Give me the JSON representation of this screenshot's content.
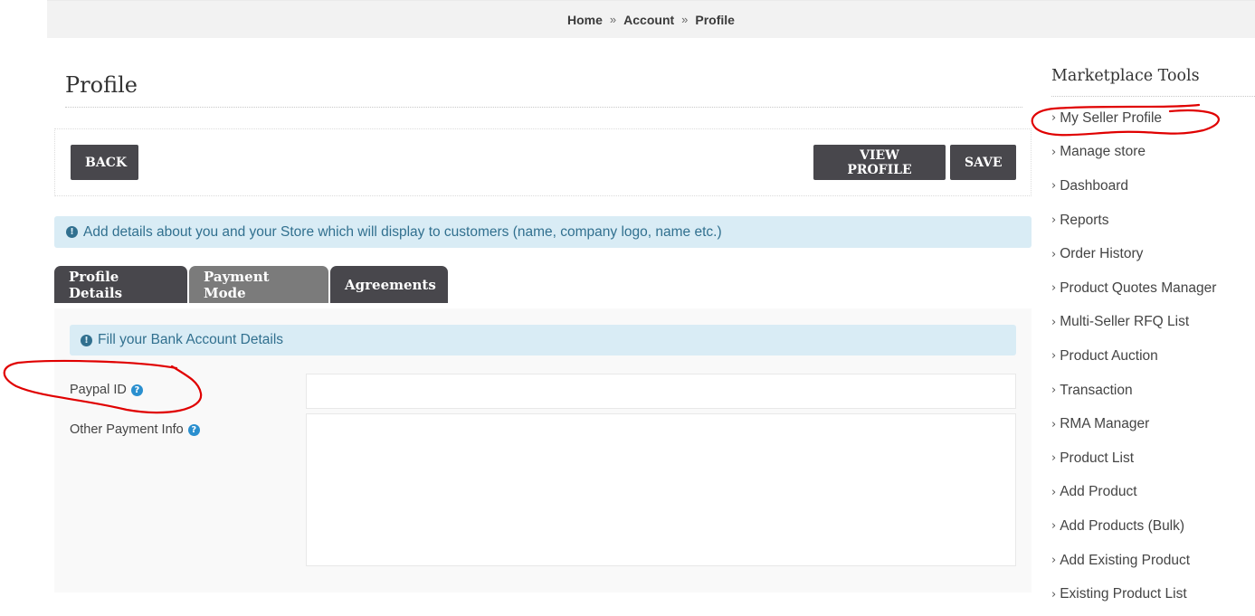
{
  "breadcrumb": {
    "items": [
      "Home",
      "Account",
      "Profile"
    ],
    "separator": "»"
  },
  "page": {
    "title": "Profile"
  },
  "toolbar": {
    "back_label": "BACK",
    "view_profile_label": "VIEW PROFILE",
    "save_label": "SAVE"
  },
  "info_alert": {
    "icon": "exclamation-circle-icon",
    "text": "Add details about you and your Store which will display to customers (name, company logo, name etc.)"
  },
  "tabs": [
    {
      "label": "Profile Details",
      "active": false
    },
    {
      "label": "Payment Mode",
      "active": true
    },
    {
      "label": "Agreements",
      "active": false
    }
  ],
  "payment_panel": {
    "alert_icon": "exclamation-circle-icon",
    "alert_text": "Fill your Bank Account Details",
    "fields": {
      "paypal_id": {
        "label": "Paypal ID",
        "value": "",
        "placeholder": "",
        "help_icon": "question-circle-icon"
      },
      "other_payment_info": {
        "label": "Other Payment Info",
        "value": "",
        "placeholder": "",
        "help_icon": "question-circle-icon"
      }
    }
  },
  "sidebar": {
    "title": "Marketplace Tools",
    "chevron": "›",
    "items": [
      {
        "label": "My Seller Profile"
      },
      {
        "label": "Manage store"
      },
      {
        "label": "Dashboard"
      },
      {
        "label": "Reports"
      },
      {
        "label": "Order History"
      },
      {
        "label": "Product Quotes Manager"
      },
      {
        "label": "Multi-Seller RFQ List"
      },
      {
        "label": "Product Auction"
      },
      {
        "label": "Transaction"
      },
      {
        "label": "RMA Manager"
      },
      {
        "label": "Product List"
      },
      {
        "label": "Add Product"
      },
      {
        "label": "Add Products (Bulk)"
      },
      {
        "label": "Add Existing Product"
      },
      {
        "label": "Existing Product List"
      }
    ]
  },
  "annotations": {
    "color": "#e00000",
    "highlighted": [
      "My Seller Profile",
      "Paypal ID"
    ]
  },
  "colors": {
    "button_bg": "#48474c",
    "tab_active_bg": "#7b7b7b",
    "alert_bg": "#d9ecf5",
    "alert_text": "#31708f",
    "help_icon": "#2a8fcf"
  }
}
